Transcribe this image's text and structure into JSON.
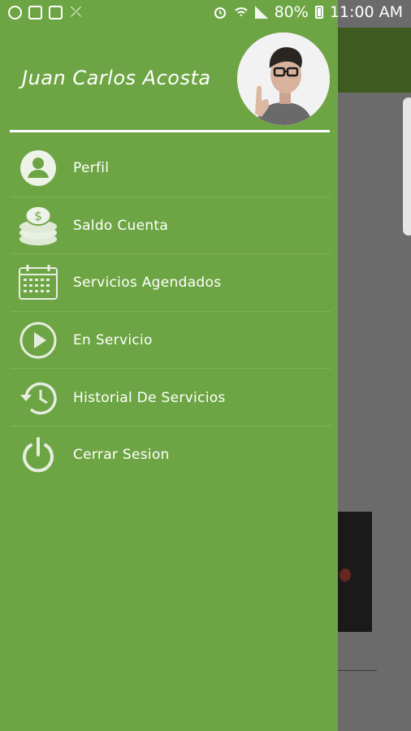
{
  "status_bar": {
    "battery_percent": "80%",
    "time": "11:00 AM"
  },
  "drawer": {
    "user_name": "Juan Carlos Acosta",
    "menu_items": [
      {
        "label": "Perfil",
        "icon": "profile-icon"
      },
      {
        "label": "Saldo Cuenta",
        "icon": "coins-icon"
      },
      {
        "label": "Servicios Agendados",
        "icon": "calendar-icon"
      },
      {
        "label": "En Servicio",
        "icon": "play-icon"
      },
      {
        "label": "Historial De Servicios",
        "icon": "history-icon"
      },
      {
        "label": "Cerrar Sesion",
        "icon": "power-icon"
      }
    ]
  },
  "colors": {
    "drawer_bg": "#6ea544",
    "toolbar_bg": "#3f5a1e",
    "overlay": "#6b6b6b",
    "icon": "#e6ede0"
  }
}
